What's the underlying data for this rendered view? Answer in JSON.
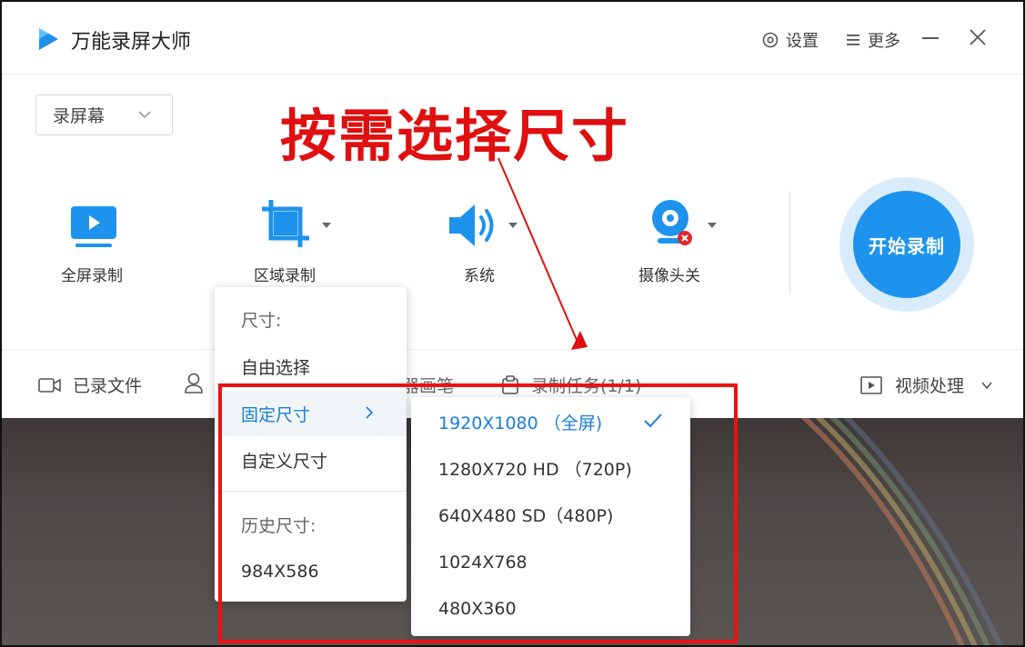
{
  "titlebar": {
    "app_title": "万能录屏大师",
    "settings_label": "设置",
    "more_label": "更多"
  },
  "mode_select": {
    "value": "录屏幕"
  },
  "annotation": {
    "text": "按需选择尺寸"
  },
  "tools": [
    {
      "label": "全屏录制",
      "icon": "monitor-play-icon"
    },
    {
      "label": "区域录制",
      "icon": "crop-icon"
    },
    {
      "label": "系统",
      "icon": "speaker-icon"
    },
    {
      "label": "摄像头关",
      "icon": "webcam-icon"
    }
  ],
  "start_button": {
    "label": "开始录制"
  },
  "bottombar": {
    "recorded_files": "已录文件",
    "partial_2": "器画笔",
    "partial_3": "录制任务(1/1)",
    "video_process": "视频处理"
  },
  "size_menu": {
    "header": "尺寸:",
    "free_select": "自由选择",
    "fixed_size": "固定尺寸",
    "custom_size": "自定义尺寸",
    "history_header": "历史尺寸:",
    "history_item": "984X586"
  },
  "fixed_sizes": [
    {
      "label": "1920X1080 （全屏)",
      "selected": true
    },
    {
      "label": "1280X720 HD （720P)",
      "selected": false
    },
    {
      "label": "640X480 SD（480P)",
      "selected": false
    },
    {
      "label": "1024X768",
      "selected": false
    },
    {
      "label": "480X360",
      "selected": false
    }
  ],
  "colors": {
    "accent": "#1d93ee",
    "active_text": "#1b7ed8",
    "annotation_red": "#e01010"
  }
}
